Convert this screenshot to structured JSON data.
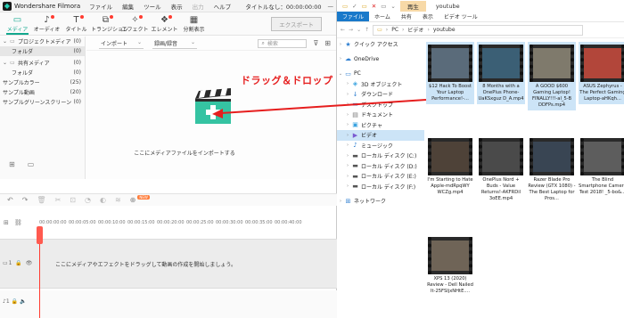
{
  "filmora": {
    "app_name": "Wondershare Filmora",
    "menu": [
      "ファイル",
      "編集",
      "ツール",
      "表示",
      "出力",
      "ヘルプ"
    ],
    "menu_disabled_index": 4,
    "project_title": "タイトルなし：00:00:00:00",
    "tools": [
      {
        "label": "メディア",
        "icon": "folder-icon",
        "glyph": "▭",
        "active": true,
        "dot": false
      },
      {
        "label": "オーディオ",
        "icon": "music-icon",
        "glyph": "♪",
        "active": false,
        "dot": true
      },
      {
        "label": "タイトル",
        "icon": "text-icon",
        "glyph": "T",
        "active": false,
        "dot": true
      },
      {
        "label": "トランジション",
        "icon": "transition-icon",
        "glyph": "⧉",
        "active": false,
        "dot": true
      },
      {
        "label": "エフェクト",
        "icon": "effect-icon",
        "glyph": "✧",
        "active": false,
        "dot": true
      },
      {
        "label": "エレメント",
        "icon": "element-icon",
        "glyph": "❖",
        "active": false,
        "dot": true
      },
      {
        "label": "分割表示",
        "icon": "split-icon",
        "glyph": "▦",
        "active": false,
        "dot": false
      }
    ],
    "export_label": "エクスポート",
    "library": [
      {
        "label": "プロジェクトメディア",
        "count": "(0)",
        "type": "group",
        "hl": false
      },
      {
        "label": "フォルダ",
        "count": "(0)",
        "type": "item",
        "hl": true
      },
      {
        "label": "共有メディア",
        "count": "(0)",
        "type": "group",
        "hl": false
      },
      {
        "label": "フォルダ",
        "count": "(0)",
        "type": "item",
        "hl": false
      },
      {
        "label": "サンプルカラー",
        "count": "(25)",
        "type": "plain",
        "hl": false
      },
      {
        "label": "サンプル動画",
        "count": "(20)",
        "type": "plain",
        "hl": false
      },
      {
        "label": "サンプルグリーンスクリーン",
        "count": "(0)",
        "type": "plain",
        "hl": false
      }
    ],
    "import_dropdown": "インポート",
    "record_dropdown": "録画/録音",
    "search_placeholder": "検索",
    "import_hint": "ここにメディアファイルをインポートする",
    "new_badge": "NEW",
    "ruler": [
      "00:00:00:00",
      "00:00:05:00",
      "00:00:10:00",
      "00:00:15:00",
      "00:00:20:00",
      "00:00:25:00",
      "00:00:30:00",
      "00:00:35:00",
      "00:00:40:00"
    ],
    "timeline_hint": "ここにメディアやエフェクトをドラッグして動画の作成を開始しましょう。",
    "video_track_label": "1",
    "audio_track_label": "1"
  },
  "annotation": {
    "drag_label": "ドラッグ＆ドロップ",
    "arrow_color": "#e61e1e"
  },
  "explorer": {
    "play_tab": "再生",
    "window_title": "youtube",
    "ribbon": [
      "ファイル",
      "ホーム",
      "共有",
      "表示",
      "ビデオ ツール"
    ],
    "path": [
      "PC",
      "ビデオ",
      "youtube"
    ],
    "nav": [
      {
        "label": "クイック アクセス",
        "icon": "star-icon",
        "glyph": "★",
        "color": "#2f7fd1",
        "level": 0,
        "arrow": "›",
        "sel": false,
        "gap": false
      },
      {
        "label": "OneDrive",
        "icon": "cloud-icon",
        "glyph": "☁",
        "color": "#2f7fd1",
        "level": 0,
        "arrow": "›",
        "sel": false,
        "gap": true
      },
      {
        "label": "PC",
        "icon": "pc-icon",
        "glyph": "▭",
        "color": "#2f7fd1",
        "level": 0,
        "arrow": "⌄",
        "sel": false,
        "gap": true
      },
      {
        "label": "3D オブジェクト",
        "icon": "cube-icon",
        "glyph": "◈",
        "color": "#3aa3e0",
        "level": 1,
        "arrow": "›",
        "sel": false,
        "gap": false
      },
      {
        "label": "ダウンロード",
        "icon": "download-icon",
        "glyph": "↓",
        "color": "#2f7fd1",
        "level": 1,
        "arrow": "›",
        "sel": false,
        "gap": false
      },
      {
        "label": "デスクトップ",
        "icon": "desktop-icon",
        "glyph": "▬",
        "color": "#2f7fd1",
        "level": 1,
        "arrow": "›",
        "sel": false,
        "gap": false
      },
      {
        "label": "ドキュメント",
        "icon": "document-icon",
        "glyph": "▤",
        "color": "#7a7a7a",
        "level": 1,
        "arrow": "›",
        "sel": false,
        "gap": false
      },
      {
        "label": "ピクチャ",
        "icon": "picture-icon",
        "glyph": "▣",
        "color": "#3aa3e0",
        "level": 1,
        "arrow": "›",
        "sel": false,
        "gap": false
      },
      {
        "label": "ビデオ",
        "icon": "video-icon",
        "glyph": "▶",
        "color": "#7a5ad1",
        "level": 1,
        "arrow": "›",
        "sel": true,
        "gap": false
      },
      {
        "label": "ミュージック",
        "icon": "music-icon",
        "glyph": "♪",
        "color": "#2f7fd1",
        "level": 1,
        "arrow": "›",
        "sel": false,
        "gap": false
      },
      {
        "label": "ローカル ディスク (C:)",
        "icon": "drive-icon",
        "glyph": "▬",
        "color": "#555",
        "level": 1,
        "arrow": "›",
        "sel": false,
        "gap": false
      },
      {
        "label": "ローカル ディスク (D:)",
        "icon": "drive-icon",
        "glyph": "▬",
        "color": "#555",
        "level": 1,
        "arrow": "›",
        "sel": false,
        "gap": false
      },
      {
        "label": "ローカル ディスク (E:)",
        "icon": "drive-icon",
        "glyph": "▬",
        "color": "#555",
        "level": 1,
        "arrow": "›",
        "sel": false,
        "gap": false
      },
      {
        "label": "ローカル ディスク (F:)",
        "icon": "drive-icon",
        "glyph": "▬",
        "color": "#555",
        "level": 1,
        "arrow": "›",
        "sel": false,
        "gap": false
      },
      {
        "label": "ネットワーク",
        "icon": "network-icon",
        "glyph": "⊞",
        "color": "#2f7fd1",
        "level": 0,
        "arrow": "›",
        "sel": false,
        "gap": true
      }
    ],
    "files": [
      {
        "caption": "$12 Hack To Boost Your Laptop Performance!-...",
        "thumb": "#5a6b7a",
        "sel": true
      },
      {
        "caption": "8 Months with a OnePlus Phone-UaKSxguz D_A.mp4",
        "thumb": "#3b5f75",
        "sel": true
      },
      {
        "caption": "A GOOD $600 Gaming Laptop! FINALLY!!!-al_5-B DDFPs.mp4",
        "thumb": "#7f7a6c",
        "sel": true
      },
      {
        "caption": "ASUS Zephyrus - The Perfect Gaming Laptop-aHKqh...",
        "thumb": "#b2463a",
        "sel": true
      },
      {
        "caption": "I'm Starting to Hate Apple-mdRpqWY WCZg.mp4",
        "thumb": "#4e4238",
        "sel": false
      },
      {
        "caption": "OnePlus Nord + Buds - Value Returns!-AKFRDil 3oEE.mp4",
        "thumb": "#4a4a4a",
        "sel": false
      },
      {
        "caption": "Razer Blade Pro Review (GTX 1080) - The Best Laptop for Pros...",
        "thumb": "#394553",
        "sel": false
      },
      {
        "caption": "The Blind Smartphone Camera Test 2018! _5-bo&...",
        "thumb": "#5d5d5d",
        "sel": false
      },
      {
        "caption": "XPS 13 (2020) Review - Dell Nailed It-25FSIjxNHtE....",
        "thumb": "#6f6457",
        "sel": false
      }
    ]
  },
  "colors": {
    "accent": "#12a88e",
    "explorer_selection": "#cce4f7",
    "playhead": "#ff3b30"
  }
}
